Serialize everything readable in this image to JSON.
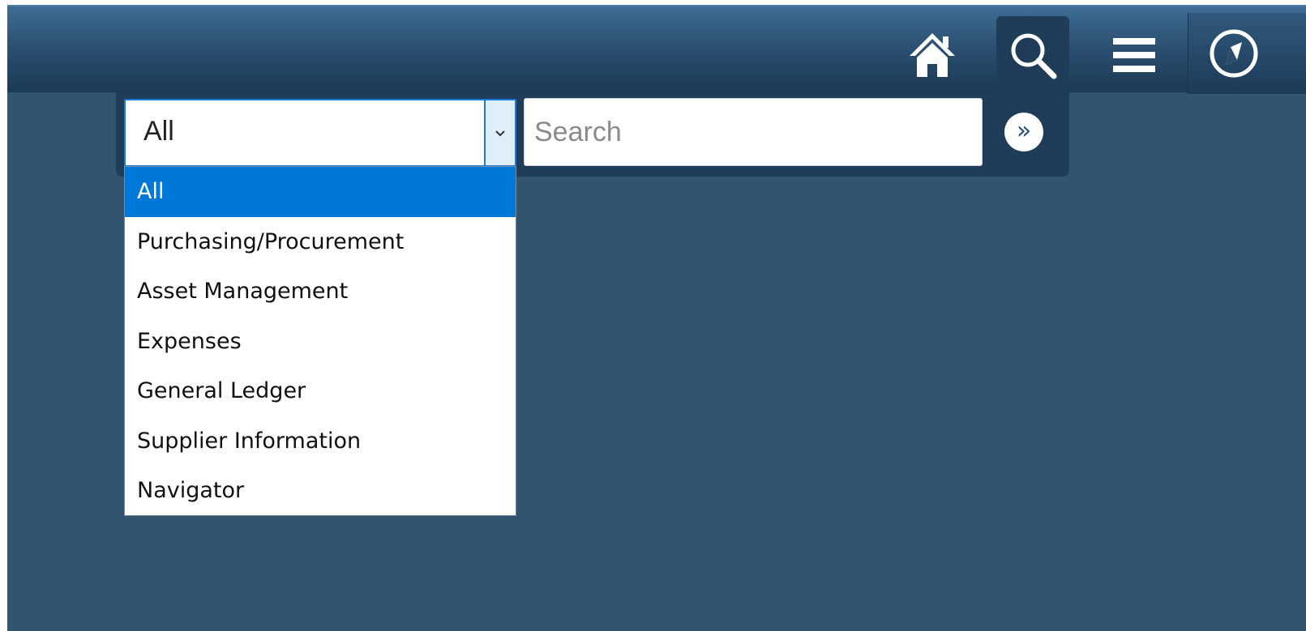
{
  "header": {
    "icons": [
      "home-icon",
      "search-icon",
      "menu-icon",
      "compass-icon"
    ]
  },
  "search": {
    "category_value": "All",
    "placeholder": "Search",
    "input_value": "",
    "go_glyph": "»",
    "dropdown_options": [
      {
        "label": "All",
        "selected": true
      },
      {
        "label": "Purchasing/Procurement",
        "selected": false
      },
      {
        "label": "Asset Management",
        "selected": false
      },
      {
        "label": "Expenses",
        "selected": false
      },
      {
        "label": "General Ledger",
        "selected": false
      },
      {
        "label": "Supplier Information",
        "selected": false
      },
      {
        "label": "Navigator",
        "selected": false
      }
    ]
  },
  "colors": {
    "header_top": "#3e6d93",
    "header_bottom": "#1b3954",
    "background": "#325471",
    "panel": "#1f3d58",
    "selection": "#0078d7",
    "focus_border": "#1d7ad8"
  }
}
